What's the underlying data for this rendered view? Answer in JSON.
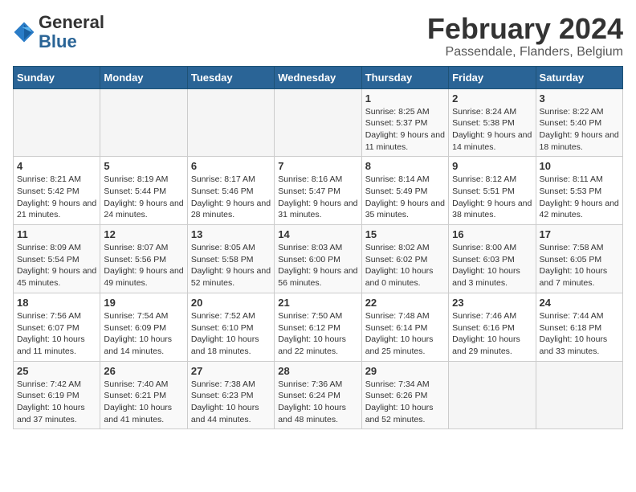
{
  "header": {
    "logo_general": "General",
    "logo_blue": "Blue",
    "month_title": "February 2024",
    "location": "Passendale, Flanders, Belgium"
  },
  "days_of_week": [
    "Sunday",
    "Monday",
    "Tuesday",
    "Wednesday",
    "Thursday",
    "Friday",
    "Saturday"
  ],
  "weeks": [
    [
      {
        "day": "",
        "info": ""
      },
      {
        "day": "",
        "info": ""
      },
      {
        "day": "",
        "info": ""
      },
      {
        "day": "",
        "info": ""
      },
      {
        "day": "1",
        "info": "Sunrise: 8:25 AM\nSunset: 5:37 PM\nDaylight: 9 hours and 11 minutes."
      },
      {
        "day": "2",
        "info": "Sunrise: 8:24 AM\nSunset: 5:38 PM\nDaylight: 9 hours and 14 minutes."
      },
      {
        "day": "3",
        "info": "Sunrise: 8:22 AM\nSunset: 5:40 PM\nDaylight: 9 hours and 18 minutes."
      }
    ],
    [
      {
        "day": "4",
        "info": "Sunrise: 8:21 AM\nSunset: 5:42 PM\nDaylight: 9 hours and 21 minutes."
      },
      {
        "day": "5",
        "info": "Sunrise: 8:19 AM\nSunset: 5:44 PM\nDaylight: 9 hours and 24 minutes."
      },
      {
        "day": "6",
        "info": "Sunrise: 8:17 AM\nSunset: 5:46 PM\nDaylight: 9 hours and 28 minutes."
      },
      {
        "day": "7",
        "info": "Sunrise: 8:16 AM\nSunset: 5:47 PM\nDaylight: 9 hours and 31 minutes."
      },
      {
        "day": "8",
        "info": "Sunrise: 8:14 AM\nSunset: 5:49 PM\nDaylight: 9 hours and 35 minutes."
      },
      {
        "day": "9",
        "info": "Sunrise: 8:12 AM\nSunset: 5:51 PM\nDaylight: 9 hours and 38 minutes."
      },
      {
        "day": "10",
        "info": "Sunrise: 8:11 AM\nSunset: 5:53 PM\nDaylight: 9 hours and 42 minutes."
      }
    ],
    [
      {
        "day": "11",
        "info": "Sunrise: 8:09 AM\nSunset: 5:54 PM\nDaylight: 9 hours and 45 minutes."
      },
      {
        "day": "12",
        "info": "Sunrise: 8:07 AM\nSunset: 5:56 PM\nDaylight: 9 hours and 49 minutes."
      },
      {
        "day": "13",
        "info": "Sunrise: 8:05 AM\nSunset: 5:58 PM\nDaylight: 9 hours and 52 minutes."
      },
      {
        "day": "14",
        "info": "Sunrise: 8:03 AM\nSunset: 6:00 PM\nDaylight: 9 hours and 56 minutes."
      },
      {
        "day": "15",
        "info": "Sunrise: 8:02 AM\nSunset: 6:02 PM\nDaylight: 10 hours and 0 minutes."
      },
      {
        "day": "16",
        "info": "Sunrise: 8:00 AM\nSunset: 6:03 PM\nDaylight: 10 hours and 3 minutes."
      },
      {
        "day": "17",
        "info": "Sunrise: 7:58 AM\nSunset: 6:05 PM\nDaylight: 10 hours and 7 minutes."
      }
    ],
    [
      {
        "day": "18",
        "info": "Sunrise: 7:56 AM\nSunset: 6:07 PM\nDaylight: 10 hours and 11 minutes."
      },
      {
        "day": "19",
        "info": "Sunrise: 7:54 AM\nSunset: 6:09 PM\nDaylight: 10 hours and 14 minutes."
      },
      {
        "day": "20",
        "info": "Sunrise: 7:52 AM\nSunset: 6:10 PM\nDaylight: 10 hours and 18 minutes."
      },
      {
        "day": "21",
        "info": "Sunrise: 7:50 AM\nSunset: 6:12 PM\nDaylight: 10 hours and 22 minutes."
      },
      {
        "day": "22",
        "info": "Sunrise: 7:48 AM\nSunset: 6:14 PM\nDaylight: 10 hours and 25 minutes."
      },
      {
        "day": "23",
        "info": "Sunrise: 7:46 AM\nSunset: 6:16 PM\nDaylight: 10 hours and 29 minutes."
      },
      {
        "day": "24",
        "info": "Sunrise: 7:44 AM\nSunset: 6:18 PM\nDaylight: 10 hours and 33 minutes."
      }
    ],
    [
      {
        "day": "25",
        "info": "Sunrise: 7:42 AM\nSunset: 6:19 PM\nDaylight: 10 hours and 37 minutes."
      },
      {
        "day": "26",
        "info": "Sunrise: 7:40 AM\nSunset: 6:21 PM\nDaylight: 10 hours and 41 minutes."
      },
      {
        "day": "27",
        "info": "Sunrise: 7:38 AM\nSunset: 6:23 PM\nDaylight: 10 hours and 44 minutes."
      },
      {
        "day": "28",
        "info": "Sunrise: 7:36 AM\nSunset: 6:24 PM\nDaylight: 10 hours and 48 minutes."
      },
      {
        "day": "29",
        "info": "Sunrise: 7:34 AM\nSunset: 6:26 PM\nDaylight: 10 hours and 52 minutes."
      },
      {
        "day": "",
        "info": ""
      },
      {
        "day": "",
        "info": ""
      }
    ]
  ]
}
